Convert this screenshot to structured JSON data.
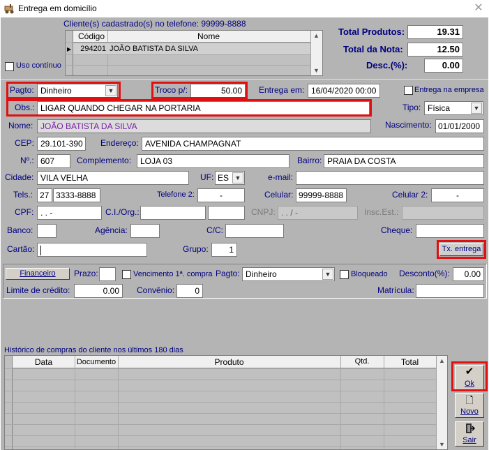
{
  "window": {
    "title": "Entrega em domicílio",
    "close": "✕"
  },
  "clients": {
    "header": "Cliente(s) cadastrado(s) no telefone: 99999-8888",
    "columns": [
      "Código",
      "Nome"
    ],
    "rows": [
      {
        "code": "294201",
        "name": "JOÃO BATISTA DA SILVA"
      }
    ],
    "uso_continuo": "Uso contínuo"
  },
  "totals": {
    "total_produtos_label": "Total Produtos:",
    "total_produtos": "19.31",
    "total_nota_label": "Total da Nota:",
    "total_nota": "12.50",
    "desc_label": "Desc.(%):",
    "desc": "0.00"
  },
  "order": {
    "pagto_label": "Pagto:",
    "pagto": "Dinheiro",
    "troco_label": "Troco p/:",
    "troco": "50.00",
    "entrega_label": "Entrega em:",
    "entrega": "16/04/2020 00:00",
    "entrega_empresa": "Entrega na empresa",
    "obs_label": "Obs.:",
    "obs": "LIGAR QUANDO CHEGAR NA PORTARIA",
    "tipo_label": "Tipo:",
    "tipo": "Física"
  },
  "customer": {
    "nome_label": "Nome:",
    "nome": "JOÃO BATISTA DA SILVA",
    "nascimento_label": "Nascimento:",
    "nascimento": "01/01/2000",
    "cep_label": "CEP:",
    "cep": "29.101-390",
    "endereco_label": "Endereço:",
    "endereco": "AVENIDA CHAMPAGNAT",
    "numero_label": "Nº.:",
    "numero": "607",
    "complemento_label": "Complemento:",
    "complemento": "LOJA 03",
    "bairro_label": "Bairro:",
    "bairro": "PRAIA DA COSTA",
    "cidade_label": "Cidade:",
    "cidade": "VILA VELHA",
    "uf_label": "UF:",
    "uf": "ES",
    "email_label": "e-mail:",
    "email": "",
    "tels_label": "Tels.:",
    "ddd": "27",
    "tel": "3333-8888",
    "tel2_label": "Telefone 2:",
    "tel2": "-",
    "celular_label": "Celular:",
    "celular": "99999-8888",
    "celular2_label": "Celular 2:",
    "celular2": "-",
    "cpf_label": "CPF:",
    "cpf": ".   .   -",
    "ci_label": "C.I./Org.:",
    "cnpj_label": "CNPJ:",
    "cnpj": ".   .   /   -",
    "insc_label": "Insc.Est.:",
    "banco_label": "Banco:",
    "agencia_label": "Agência:",
    "cc_label": "C/C:",
    "cheque_label": "Cheque:",
    "cartao_label": "Cartão:",
    "grupo_label": "Grupo:",
    "grupo": "1",
    "tx_entrega": "Tx. entrega"
  },
  "financeiro": {
    "button": "Financeiro",
    "prazo_label": "Prazo:",
    "vencimento": "Vencimento 1ª. compra",
    "pagto_label": "Pagto:",
    "pagto": "Dinheiro",
    "bloqueado": "Bloqueado",
    "desconto_label": "Desconto(%):",
    "desconto": "0.00",
    "limite_label": "Limite de crédito:",
    "limite": "0.00",
    "convenio_label": "Convênio:",
    "convenio": "0",
    "matricula_label": "Matrícula:"
  },
  "history": {
    "title": "Histórico de compras do cliente nos últimos 180 dias",
    "columns": [
      "Data",
      "Documento",
      "Produto",
      "Qtd.",
      "Total"
    ]
  },
  "actions": {
    "ok": "Ok",
    "novo": "Novo",
    "sair": "Sair"
  }
}
